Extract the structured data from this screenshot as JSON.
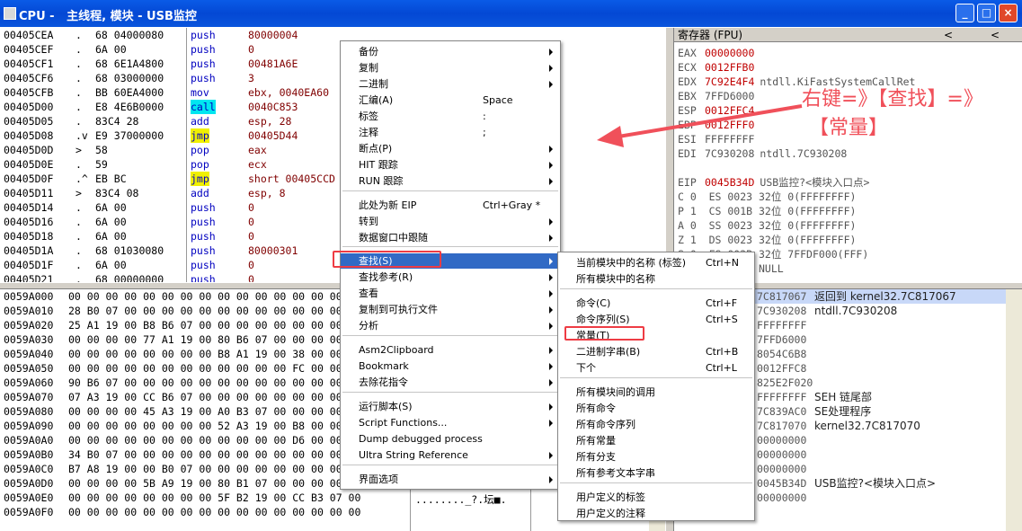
{
  "window": {
    "title": "CPU -   主线程, 模块 - USB监控",
    "buttons": [
      "_",
      "□",
      "×"
    ]
  },
  "disasm": {
    "rows": [
      {
        "addr": "00405CEA",
        "mark": ".",
        "hex": "68 04000080",
        "cmd": "push",
        "arg": "80000004",
        "hl": ""
      },
      {
        "addr": "00405CEF",
        "mark": ".",
        "hex": "6A 00",
        "cmd": "push",
        "arg": "0",
        "hl": ""
      },
      {
        "addr": "00405CF1",
        "mark": ".",
        "hex": "68 6E1A4800",
        "cmd": "push",
        "arg": "00481A6E",
        "hl": ""
      },
      {
        "addr": "00405CF6",
        "mark": ".",
        "hex": "68 03000000",
        "cmd": "push",
        "arg": "3",
        "hl": ""
      },
      {
        "addr": "00405CFB",
        "mark": ".",
        "hex": "BB 60EA4000",
        "cmd": "mov",
        "arg": "ebx, 0040EA60",
        "hl": ""
      },
      {
        "addr": "00405D00",
        "mark": ".",
        "hex": "E8 4E6B0000",
        "cmd": "call",
        "arg": "0040C853",
        "hl": "call"
      },
      {
        "addr": "00405D05",
        "mark": ".",
        "hex": "83C4 28",
        "cmd": "add",
        "arg": "esp, 28",
        "hl": ""
      },
      {
        "addr": "00405D08",
        "mark": ".v",
        "hex": "E9 37000000",
        "cmd": "jmp",
        "arg": "00405D44",
        "hl": "jmp"
      },
      {
        "addr": "00405D0D",
        "mark": ">",
        "hex": "58",
        "cmd": "pop",
        "arg": "eax",
        "hl": ""
      },
      {
        "addr": "00405D0E",
        "mark": ".",
        "hex": "59",
        "cmd": "pop",
        "arg": "ecx",
        "hl": ""
      },
      {
        "addr": "00405D0F",
        "mark": ".^",
        "hex": "EB BC",
        "cmd": "jmp",
        "arg": "short 00405CCD",
        "hl": "jmp"
      },
      {
        "addr": "00405D11",
        "mark": ">",
        "hex": "83C4 08",
        "cmd": "add",
        "arg": "esp, 8",
        "hl": ""
      },
      {
        "addr": "00405D14",
        "mark": ".",
        "hex": "6A 00",
        "cmd": "push",
        "arg": "0",
        "hl": ""
      },
      {
        "addr": "00405D16",
        "mark": ".",
        "hex": "6A 00",
        "cmd": "push",
        "arg": "0",
        "hl": ""
      },
      {
        "addr": "00405D18",
        "mark": ".",
        "hex": "6A 00",
        "cmd": "push",
        "arg": "0",
        "hl": ""
      },
      {
        "addr": "00405D1A",
        "mark": ".",
        "hex": "68 01030080",
        "cmd": "push",
        "arg": "80000301",
        "hl": ""
      },
      {
        "addr": "00405D1F",
        "mark": ".",
        "hex": "6A 00",
        "cmd": "push",
        "arg": "0",
        "hl": ""
      },
      {
        "addr": "00405D21",
        "mark": ".",
        "hex": "68 00000000",
        "cmd": "push",
        "arg": "0",
        "hl": ""
      }
    ]
  },
  "registers": {
    "header": "寄存器 (FPU)",
    "nav": [
      "<",
      "<"
    ],
    "rows": [
      {
        "name": "EAX",
        "value": "00000000",
        "red": true,
        "comment": ""
      },
      {
        "name": "ECX",
        "value": "0012FFB0",
        "red": true,
        "comment": ""
      },
      {
        "name": "EDX",
        "value": "7C92E4F4",
        "red": true,
        "comment": "ntdll.KiFastSystemCallRet"
      },
      {
        "name": "EBX",
        "value": "7FFD6000",
        "red": false,
        "comment": ""
      },
      {
        "name": "ESP",
        "value": "0012FFC4",
        "red": true,
        "comment": ""
      },
      {
        "name": "EBP",
        "value": "0012FFF0",
        "red": true,
        "comment": ""
      },
      {
        "name": "ESI",
        "value": "FFFFFFFF",
        "red": false,
        "comment": ""
      },
      {
        "name": "EDI",
        "value": "7C930208",
        "red": false,
        "comment": "ntdll.7C930208"
      },
      {
        "name": "",
        "value": "",
        "red": false,
        "comment": ""
      },
      {
        "name": "EIP",
        "value": "0045B34D",
        "red": true,
        "comment": "USB监控?<模块入口点>"
      }
    ],
    "flags": [
      "C 0  ES 0023 32位 0(FFFFFFFF)",
      "P 1  CS 001B 32位 0(FFFFFFFF)",
      "A 0  SS 0023 32位 0(FFFFFFFF)",
      "Z 1  DS 0023 32位 0(FFFFFFFF)",
      "S 0  FS 003B 32位 7FFDF000(FFF)",
      "T 0  GS 0000 NULL"
    ]
  },
  "dump": {
    "rows": [
      {
        "addr": "0059A000",
        "hex": "00 00 00 00 00 00 00 00 00 00 00 00 00 00 00 00"
      },
      {
        "addr": "0059A010",
        "hex": "28 B0 07 00 00 00 00 00 00 00 00 00 00 00 00 00"
      },
      {
        "addr": "0059A020",
        "hex": "25 A1 19 00 B8 B6 07 00 00 00 00 00 00 00 00 00"
      },
      {
        "addr": "0059A030",
        "hex": "00 00 00 00 77 A1 19 00 80 B6 07 00 00 00 00 00"
      },
      {
        "addr": "0059A040",
        "hex": "00 00 00 00 00 00 00 00 B8 A1 19 00 38 00 00 00"
      },
      {
        "addr": "0059A050",
        "hex": "00 00 00 00 00 00 00 00 00 00 00 00 FC 00 00 00"
      },
      {
        "addr": "0059A060",
        "hex": "90 B6 07 00 00 00 00 00 00 00 00 00 00 00 00 00"
      },
      {
        "addr": "0059A070",
        "hex": "07 A3 19 00 CC B6 07 00 00 00 00 00 00 00 00 00"
      },
      {
        "addr": "0059A080",
        "hex": "00 00 00 00 45 A3 19 00 A0 B3 07 00 00 00 00 00"
      },
      {
        "addr": "0059A090",
        "hex": "00 00 00 00 00 00 00 00 52 A3 19 00 B8 00 00 00"
      },
      {
        "addr": "0059A0A0",
        "hex": "00 00 00 00 00 00 00 00 00 00 00 00 D6 00 00 00"
      },
      {
        "addr": "0059A0B0",
        "hex": "34 B0 07 00 00 00 00 00 00 00 00 00 00 00 00 00"
      },
      {
        "addr": "0059A0C0",
        "hex": "B7 A8 19 00 00 B0 07 00 00 00 00 00 00 00 00 00"
      },
      {
        "addr": "0059A0D0",
        "hex": "00 00 00 00 5B A9 19 00 80 B1 07 00 00 00 00 00"
      },
      {
        "addr": "0059A0E0",
        "hex": "00 00 00 00 00 00 00 00 5F B2 19 00 CC B3 07 00"
      },
      {
        "addr": "0059A0F0",
        "hex": "00 00 00 00 00 00 00 00 00 00 00 00 00 00 00 00"
      }
    ],
    "ascii_tail": "........_?.坛■."
  },
  "stack": {
    "rows": [
      {
        "val": "7C817067",
        "cmt": "返回到 kernel32.7C817067",
        "sel": true
      },
      {
        "val": "7C930208",
        "cmt": "ntdll.7C930208",
        "sel": false
      },
      {
        "val": "FFFFFFFF",
        "cmt": "",
        "sel": false
      },
      {
        "val": "7FFD6000",
        "cmt": "",
        "sel": false
      },
      {
        "val": "8054C6B8",
        "cmt": "",
        "sel": false
      },
      {
        "val": "0012FFC8",
        "cmt": "",
        "sel": false
      },
      {
        "val": "825E2F020",
        "cmt": "",
        "sel": false
      },
      {
        "val": "FFFFFFFF",
        "cmt": "SEH 链尾部",
        "sel": false
      },
      {
        "val": "7C839AC0",
        "cmt": "SE处理程序",
        "sel": false
      },
      {
        "val": "7C817070",
        "cmt": "kernel32.7C817070",
        "sel": false
      },
      {
        "val": "00000000",
        "cmt": "",
        "sel": false
      },
      {
        "val": "00000000",
        "cmt": "",
        "sel": false
      },
      {
        "val": "00000000",
        "cmt": "",
        "sel": false
      },
      {
        "val": "0045B34D",
        "cmt": "USB监控?<模块入口点>",
        "sel": false
      },
      {
        "val": "00000000",
        "cmt": "",
        "sel": false
      }
    ]
  },
  "annotation": {
    "line1": "右键=》【查找】=》",
    "line2": "【常量】"
  },
  "context_menu": {
    "items": [
      {
        "label": "备份",
        "shortcut": "",
        "arrow": true
      },
      {
        "label": "复制",
        "shortcut": "",
        "arrow": true
      },
      {
        "label": "二进制",
        "shortcut": "",
        "arrow": true
      },
      {
        "label": "汇编(A)",
        "shortcut": "Space",
        "arrow": false
      },
      {
        "label": "标签",
        "shortcut": ":",
        "arrow": false
      },
      {
        "label": "注释",
        "shortcut": ";",
        "arrow": false
      },
      {
        "label": "断点(P)",
        "shortcut": "",
        "arrow": true
      },
      {
        "label": "HIT 跟踪",
        "shortcut": "",
        "arrow": true
      },
      {
        "label": "RUN 跟踪",
        "shortcut": "",
        "arrow": true
      },
      {
        "label": "此处为新 EIP",
        "shortcut": "Ctrl+Gray *",
        "arrow": false
      },
      {
        "label": "转到",
        "shortcut": "",
        "arrow": true
      },
      {
        "label": "数据窗口中跟随",
        "shortcut": "",
        "arrow": true
      },
      {
        "label": "查找(S)",
        "shortcut": "",
        "arrow": true
      },
      {
        "label": "查找参考(R)",
        "shortcut": "",
        "arrow": true
      },
      {
        "label": "查看",
        "shortcut": "",
        "arrow": true
      },
      {
        "label": "复制到可执行文件",
        "shortcut": "",
        "arrow": true
      },
      {
        "label": "分析",
        "shortcut": "",
        "arrow": true
      },
      {
        "label": "Asm2Clipboard",
        "shortcut": "",
        "arrow": true
      },
      {
        "label": "Bookmark",
        "shortcut": "",
        "arrow": true
      },
      {
        "label": "去除花指令",
        "shortcut": "",
        "arrow": true
      },
      {
        "label": "运行脚本(S)",
        "shortcut": "",
        "arrow": true
      },
      {
        "label": "Script Functions...",
        "shortcut": "",
        "arrow": true
      },
      {
        "label": "Dump debugged process",
        "shortcut": "",
        "arrow": false
      },
      {
        "label": "Ultra String Reference",
        "shortcut": "",
        "arrow": true
      },
      {
        "label": "界面选项",
        "shortcut": "",
        "arrow": true
      }
    ]
  },
  "submenu": {
    "items": [
      {
        "label": "当前模块中的名称 (标签)",
        "shortcut": "Ctrl+N"
      },
      {
        "label": "所有模块中的名称",
        "shortcut": ""
      },
      {
        "label": "命令(C)",
        "shortcut": "Ctrl+F"
      },
      {
        "label": "命令序列(S)",
        "shortcut": "Ctrl+S"
      },
      {
        "label": "常量(T)",
        "shortcut": ""
      },
      {
        "label": "二进制字串(B)",
        "shortcut": "Ctrl+B"
      },
      {
        "label": "下个",
        "shortcut": "Ctrl+L"
      },
      {
        "label": "所有模块间的调用",
        "shortcut": ""
      },
      {
        "label": "所有命令",
        "shortcut": ""
      },
      {
        "label": "所有命令序列",
        "shortcut": ""
      },
      {
        "label": "所有常量",
        "shortcut": ""
      },
      {
        "label": "所有分支",
        "shortcut": ""
      },
      {
        "label": "所有参考文本字串",
        "shortcut": ""
      },
      {
        "label": "用户定义的标签",
        "shortcut": ""
      },
      {
        "label": "用户定义的注释",
        "shortcut": ""
      }
    ]
  },
  "colors": {
    "accent": "#316ac5",
    "annotation": "#f0505a",
    "title_bar": "#0a5be7"
  }
}
